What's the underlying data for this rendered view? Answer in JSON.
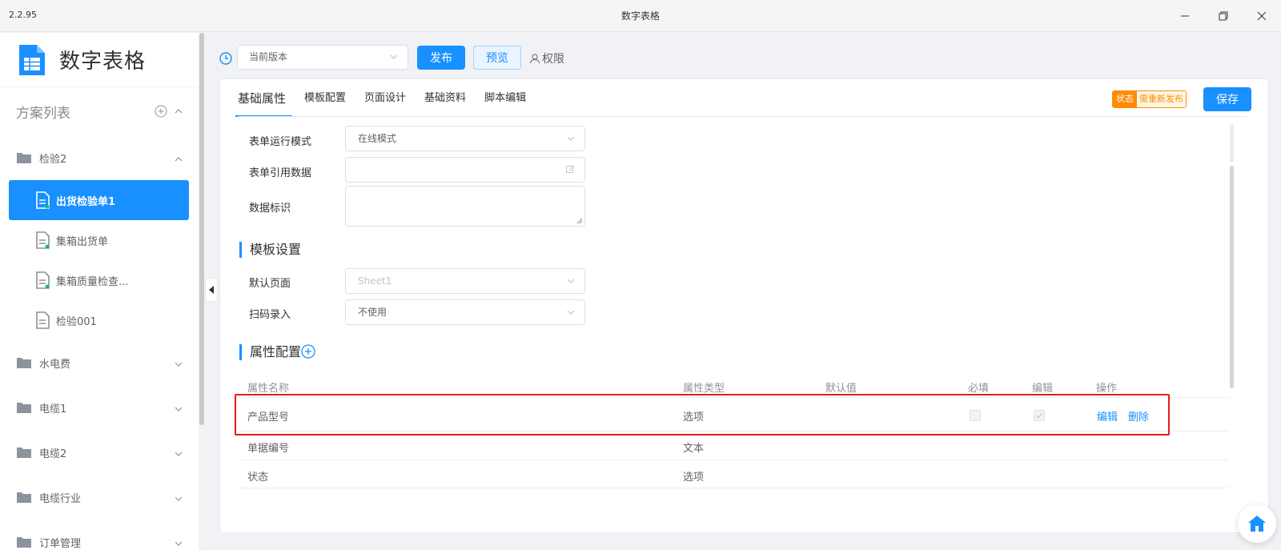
{
  "window": {
    "version": "2.2.95",
    "title": "数字表格"
  },
  "sidebar": {
    "app_name": "数字表格",
    "plan_list_title": "方案列表",
    "groups": [
      {
        "label": "检验2",
        "expanded": true,
        "items": [
          {
            "label": "出货检验单1",
            "active": true
          },
          {
            "label": "集箱出货单",
            "active": false
          },
          {
            "label": "集箱质量检查...",
            "active": false
          },
          {
            "label": "检验001",
            "active": false
          }
        ]
      },
      {
        "label": "水电费",
        "expanded": false
      },
      {
        "label": "电缆1",
        "expanded": false
      },
      {
        "label": "电缆2",
        "expanded": false
      },
      {
        "label": "电缆行业",
        "expanded": false
      },
      {
        "label": "订单管理",
        "expanded": false
      }
    ]
  },
  "toolbar": {
    "version_select": "当前版本",
    "publish_label": "发布",
    "preview_label": "预览",
    "permission_label": "权限"
  },
  "tabs": [
    {
      "label": "基础属性",
      "active": true
    },
    {
      "label": "模板配置",
      "active": false
    },
    {
      "label": "页面设计",
      "active": false
    },
    {
      "label": "基础资料",
      "active": false
    },
    {
      "label": "脚本编辑",
      "active": false
    }
  ],
  "status": {
    "label": "状态",
    "value": "需重新发布"
  },
  "save_label": "保存",
  "form": {
    "run_mode_label": "表单运行模式",
    "run_mode_value": "在线模式",
    "ref_data_label": "表单引用数据",
    "ref_data_value": "",
    "data_id_label": "数据标识",
    "data_id_value": ""
  },
  "template_section": {
    "title": "模板设置",
    "default_page_label": "默认页面",
    "default_page_value": "Sheet1",
    "scan_label": "扫码录入",
    "scan_value": "不使用"
  },
  "attr_section": {
    "title": "属性配置",
    "columns": [
      "属性名称",
      "属性类型",
      "默认值",
      "必填",
      "编辑",
      "操作"
    ],
    "rows": [
      {
        "name": "产品型号",
        "type": "选项",
        "default": "",
        "required": false,
        "editable": true,
        "actions": [
          "编辑",
          "删除"
        ]
      },
      {
        "name": "单据编号",
        "type": "文本",
        "default": "",
        "actions": []
      },
      {
        "name": "状态",
        "type": "选项",
        "default": "",
        "actions": []
      }
    ]
  },
  "colors": {
    "primary": "#1890ff",
    "status_orange": "#ff8c00",
    "highlight_red": "#e51c1c"
  }
}
